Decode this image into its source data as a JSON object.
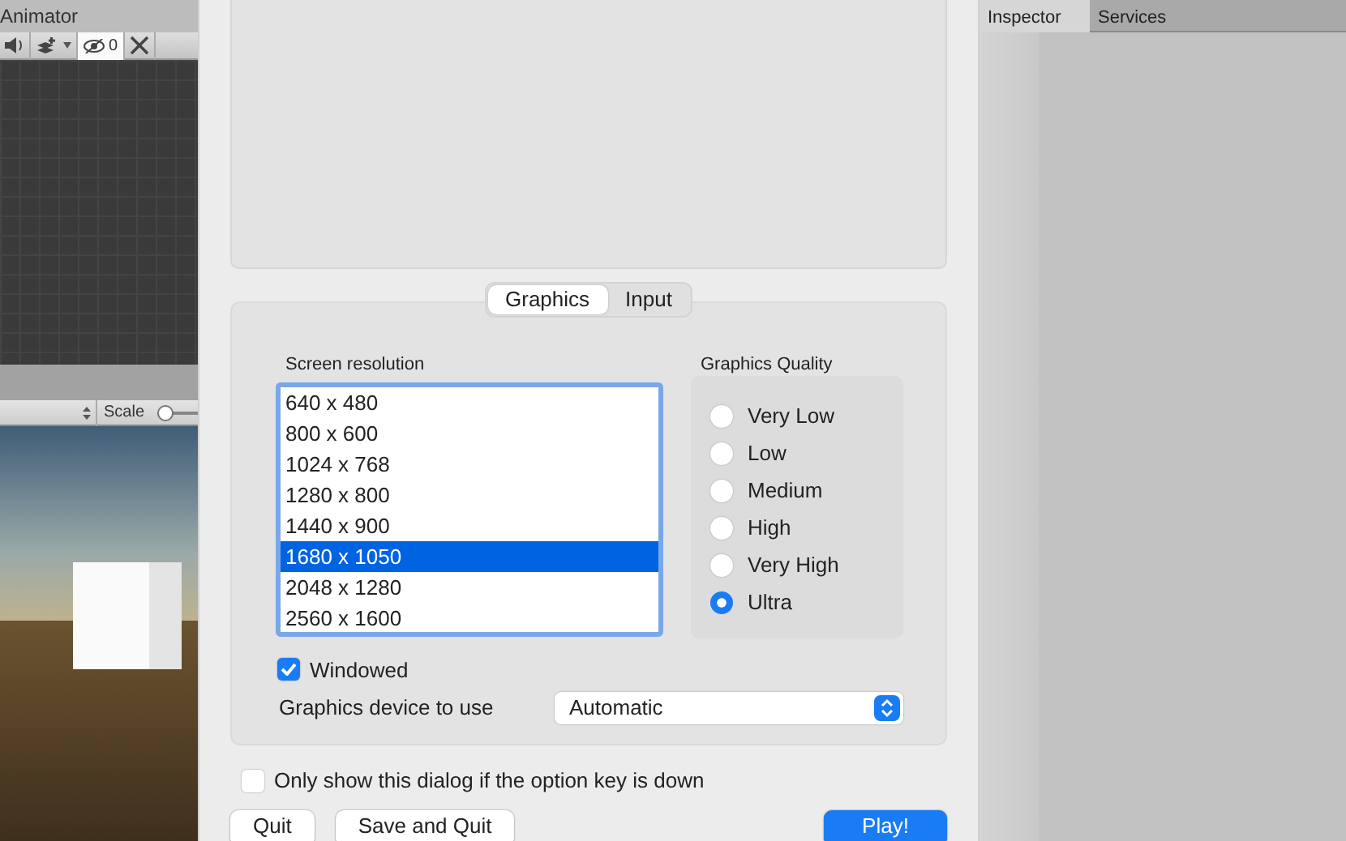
{
  "animator": {
    "title": "Animator",
    "hidden_count": "0"
  },
  "scene_toolbar": {
    "scale_label": "Scale",
    "scale_slider": {
      "level": 0
    }
  },
  "inspector_tabs": [
    {
      "label": "Inspector",
      "selected": true
    },
    {
      "label": "Services",
      "selected": false
    }
  ],
  "dialog": {
    "tabs": [
      {
        "label": "Graphics",
        "selected": true
      },
      {
        "label": "Input",
        "selected": false
      }
    ],
    "resolution": {
      "label": "Screen resolution",
      "items": [
        {
          "text": "640 x 480",
          "selected": false
        },
        {
          "text": "800 x 600",
          "selected": false
        },
        {
          "text": "1024 x 768",
          "selected": false
        },
        {
          "text": "1280 x 800",
          "selected": false
        },
        {
          "text": "1440 x 900",
          "selected": false
        },
        {
          "text": "1680 x 1050",
          "selected": true
        },
        {
          "text": "2048 x 1280",
          "selected": false
        },
        {
          "text": "2560 x 1600",
          "selected": false
        }
      ]
    },
    "quality": {
      "label": "Graphics Quality",
      "options": [
        {
          "label": "Very Low",
          "selected": false
        },
        {
          "label": "Low",
          "selected": false
        },
        {
          "label": "Medium",
          "selected": false
        },
        {
          "label": "High",
          "selected": false
        },
        {
          "label": "Very High",
          "selected": false
        },
        {
          "label": "Ultra",
          "selected": true
        }
      ]
    },
    "windowed": {
      "label": "Windowed",
      "checked": true
    },
    "device": {
      "label": "Graphics device to use",
      "value": "Automatic"
    },
    "option_key": {
      "label": "Only show this dialog if the option key is down",
      "checked": false
    },
    "buttons": [
      {
        "label": "Quit",
        "kind": "default"
      },
      {
        "label": "Save and Quit",
        "kind": "default"
      },
      {
        "label": "Play!",
        "kind": "primary"
      }
    ]
  }
}
